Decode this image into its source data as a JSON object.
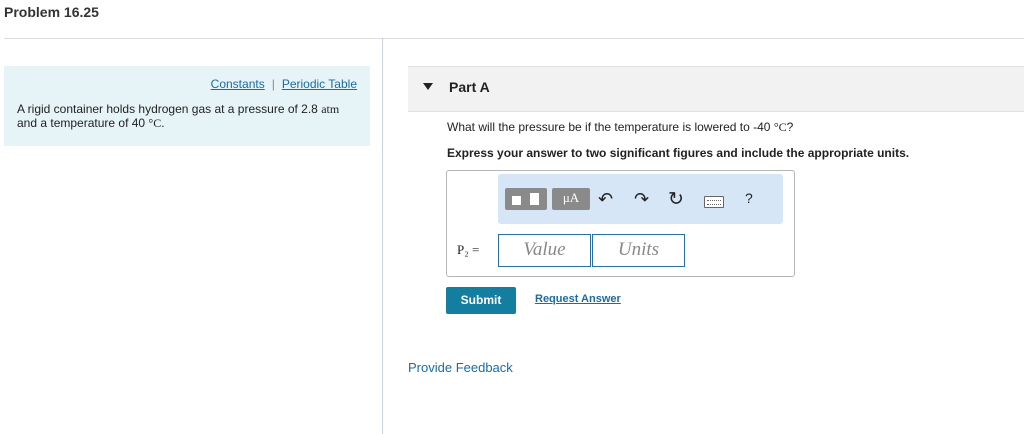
{
  "problem": {
    "title": "Problem 16.25",
    "links": {
      "constants": "Constants",
      "periodic_table": "Periodic Table",
      "separator": "|"
    },
    "text_main": "A rigid container holds hydrogen gas at a pressure of 2.8 ",
    "text_unit": "atm",
    "text_mid": " and a temperature of 40 ",
    "text_temp_unit": "°C",
    "text_end": "."
  },
  "part": {
    "label": "Part A",
    "question_main": "What will the pressure be if the temperature is lowered to -40 ",
    "question_unit": "°C",
    "question_end": "?",
    "instructions": "Express your answer to two significant figures and include the appropriate units."
  },
  "toolbar": {
    "units_label": "μA",
    "undo_glyph": "↶",
    "redo_glyph": "↷",
    "reset_glyph": "↻",
    "help_label": "?",
    "icons": [
      "templates-icon",
      "units-icon",
      "undo-icon",
      "redo-icon",
      "reset-icon",
      "keyboard-icon",
      "help-icon"
    ]
  },
  "answer": {
    "variable": "P₂",
    "equals": "=",
    "value_placeholder": "Value",
    "units_placeholder": "Units"
  },
  "actions": {
    "submit": "Submit",
    "request_answer": "Request Answer",
    "provide_feedback": "Provide Feedback"
  },
  "colors": {
    "accent": "#147ea0",
    "link": "#1b6ba4",
    "panel_bg": "#e6f4f7",
    "toolbar_bg": "#d7e6f6"
  }
}
